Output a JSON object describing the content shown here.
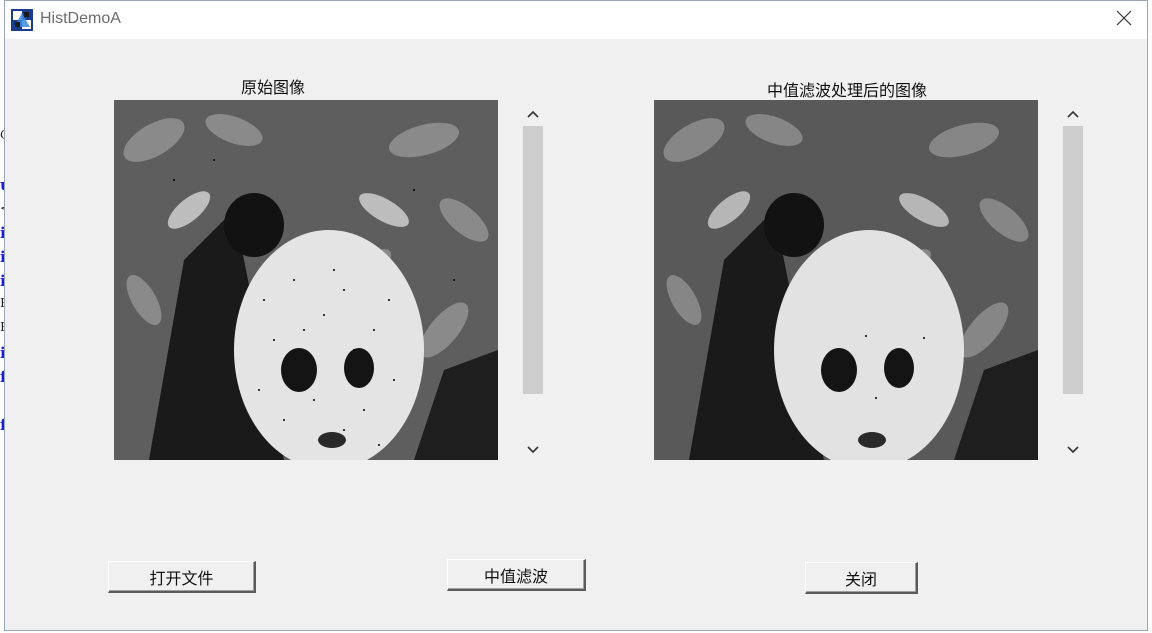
{
  "window": {
    "title": "HistDemoA"
  },
  "panels": {
    "original_caption": "原始图像",
    "filtered_caption": "中值滤波处理后的图像"
  },
  "buttons": {
    "open_file": "打开文件",
    "median_filter": "中值滤波",
    "close": "关闭"
  },
  "background_fragments": [
    "G",
    "u",
    "<",
    "i",
    "i",
    "i",
    "E",
    "E",
    "i",
    "f",
    "f"
  ],
  "colors": {
    "dialog_bg": "#f0f0f0",
    "titlebar_bg": "#ffffff",
    "scroll_thumb": "#cdcdcd",
    "bg_code_blue": "#1f1fd6"
  },
  "icons": {
    "app": "app-icon",
    "close": "close-icon",
    "scroll_up": "chevron-up-icon",
    "scroll_down": "chevron-down-icon"
  }
}
